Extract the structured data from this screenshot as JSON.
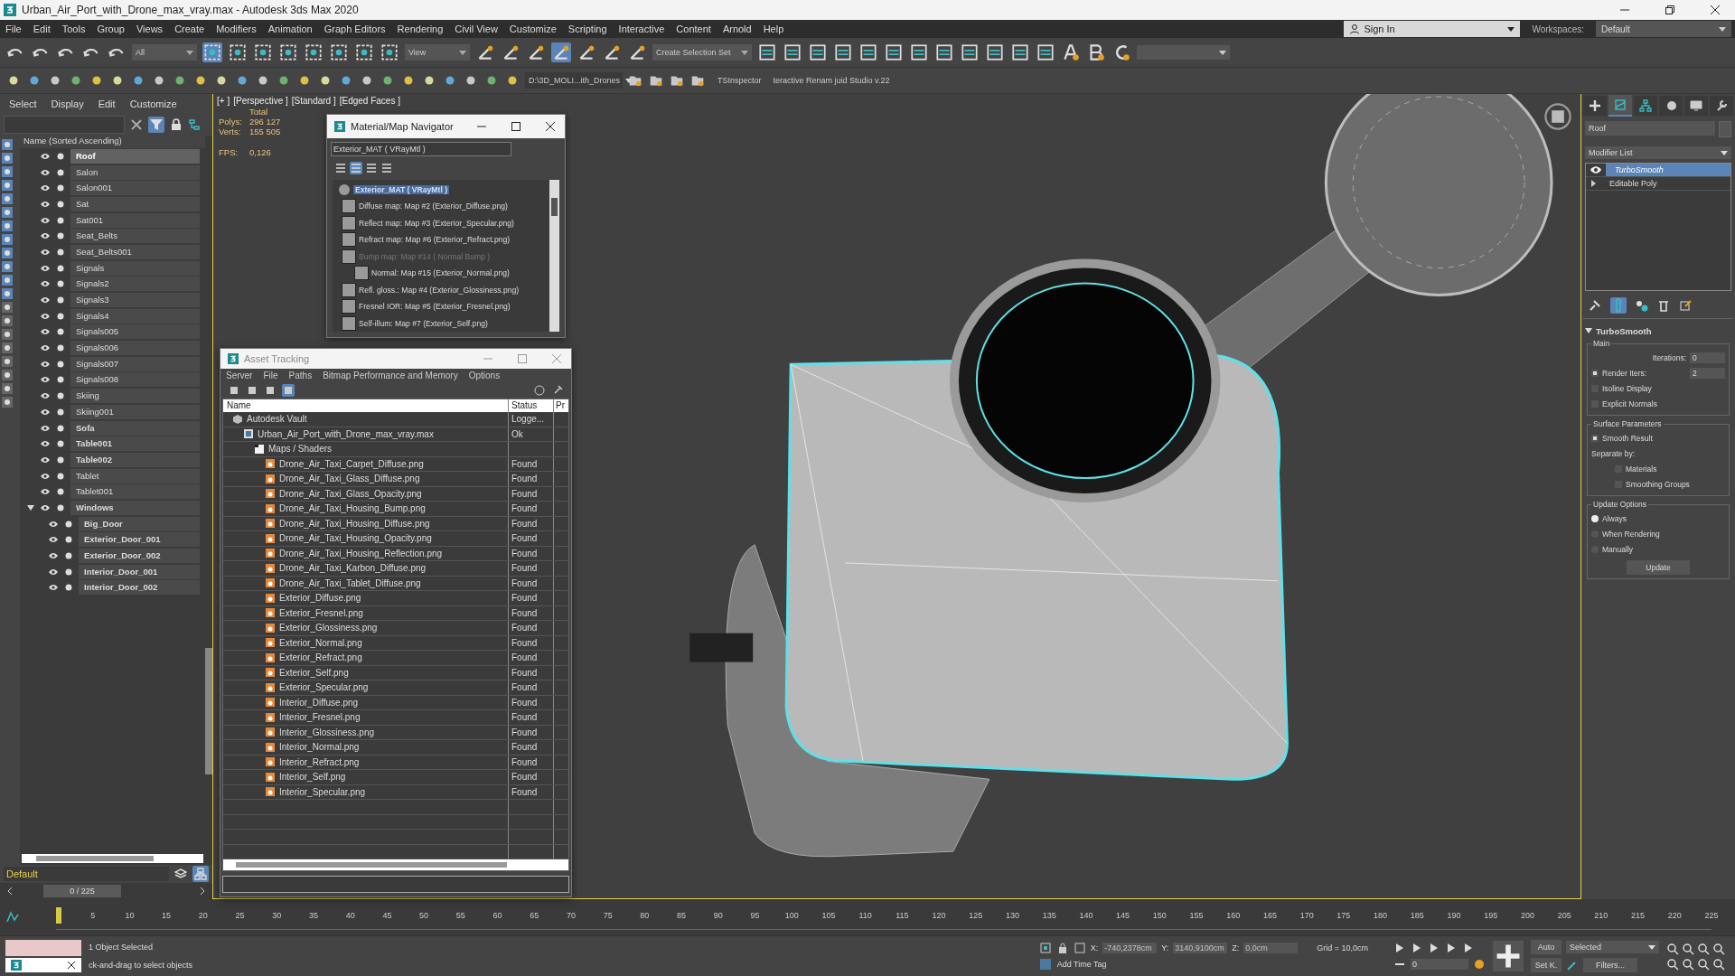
{
  "window": {
    "title": "Urban_Air_Port_with_Drone_max_vray.max - Autodesk 3ds Max 2020"
  },
  "menu_bar": [
    "File",
    "Edit",
    "Tools",
    "Group",
    "Views",
    "Create",
    "Modifiers",
    "Animation",
    "Graph Editors",
    "Rendering",
    "Civil View",
    "Customize",
    "Scripting",
    "Interactive",
    "Content",
    "Arnold",
    "Help"
  ],
  "toolbar": {
    "selection_filter": "All",
    "reference_coord": "View",
    "named_selection": "Create Selection Set"
  },
  "toolbar_2": {
    "project_path": "D:\\3D_MOLI...ith_Drones",
    "plugins": [
      "TSInspector",
      "teractive Renam juid Studio v.22"
    ]
  },
  "account": {
    "sign_in": "Sign In",
    "workspaces_label": "Workspaces:",
    "workspace": "Default"
  },
  "scene_explorer": {
    "menu": [
      "Select",
      "Display",
      "Edit",
      "Customize"
    ],
    "column": "Name (Sorted Ascending)",
    "items": [
      {
        "name": "Roof",
        "bold": true,
        "selected": true
      },
      {
        "name": "Salon",
        "bold": false,
        "selected": false
      },
      {
        "name": "Salon001",
        "bold": false,
        "selected": false
      },
      {
        "name": "Sat",
        "bold": false,
        "selected": false
      },
      {
        "name": "Sat001",
        "bold": false,
        "selected": false
      },
      {
        "name": "Seat_Belts",
        "bold": false,
        "selected": false
      },
      {
        "name": "Seat_Belts001",
        "bold": false,
        "selected": false
      },
      {
        "name": "Signals",
        "bold": false,
        "selected": false
      },
      {
        "name": "Signals2",
        "bold": false,
        "selected": false
      },
      {
        "name": "Signals3",
        "bold": false,
        "selected": false
      },
      {
        "name": "Signals4",
        "bold": false,
        "selected": false
      },
      {
        "name": "Signals005",
        "bold": false,
        "selected": false
      },
      {
        "name": "Signals006",
        "bold": false,
        "selected": false
      },
      {
        "name": "Signals007",
        "bold": false,
        "selected": false
      },
      {
        "name": "Signals008",
        "bold": false,
        "selected": false
      },
      {
        "name": "Skiing",
        "bold": false,
        "selected": false
      },
      {
        "name": "Skiing001",
        "bold": false,
        "selected": false
      },
      {
        "name": "Sofa",
        "bold": true,
        "selected": false
      },
      {
        "name": "Table001",
        "bold": true,
        "selected": false
      },
      {
        "name": "Table002",
        "bold": true,
        "selected": false
      },
      {
        "name": "Tablet",
        "bold": false,
        "selected": false
      },
      {
        "name": "Tablet001",
        "bold": false,
        "selected": false
      },
      {
        "name": "Windows",
        "bold": true,
        "selected": false,
        "expanded": true,
        "children": [
          {
            "name": "Big_Door",
            "bold": true,
            "selected": false
          },
          {
            "name": "Exterior_Door_001",
            "bold": true,
            "selected": false
          },
          {
            "name": "Exterior_Door_002",
            "bold": true,
            "selected": false
          },
          {
            "name": "Interior_Door_001",
            "bold": true,
            "selected": false
          },
          {
            "name": "Interior_Door_002",
            "bold": true,
            "selected": false
          }
        ]
      }
    ],
    "layer": "Default",
    "frame": "0 / 225"
  },
  "viewport": {
    "labels": [
      "[+ ]",
      "[Perspective ]",
      "[Standard ]",
      "[Edged Faces ]"
    ],
    "stats_header": "Total",
    "stats": [
      {
        "label": "Polys:",
        "value": "296 127"
      },
      {
        "label": "Verts:",
        "value": "155 505"
      }
    ],
    "fps_label": "FPS:",
    "fps": "0,126"
  },
  "material_navigator": {
    "title": "Material/Map Navigator",
    "field": "Exterior_MAT  ( VRayMtl )",
    "root": "Exterior_MAT  ( VRayMtl )",
    "maps": [
      {
        "label": "Diffuse map: Map #2 (Exterior_Diffuse.png)",
        "disabled": false
      },
      {
        "label": "Reflect map: Map #3 (Exterior_Specular.png)",
        "disabled": false
      },
      {
        "label": "Refract map: Map #6 (Exterior_Refract.png)",
        "disabled": false
      },
      {
        "label": "Bump map: Map #14  ( Normal Bump )",
        "disabled": true,
        "children": [
          {
            "label": "Normal: Map #15 (Exterior_Normal.png)",
            "disabled": false
          }
        ]
      },
      {
        "label": "Refl. gloss.: Map #4 (Exterior_Glossiness.png)",
        "disabled": false
      },
      {
        "label": "Fresnel IOR: Map #5 (Exterior_Fresnel.png)",
        "disabled": false
      },
      {
        "label": "Self-illum: Map #7 (Exterior_Self.png)",
        "disabled": false
      }
    ]
  },
  "asset_tracking": {
    "title": "Asset Tracking",
    "menu": [
      "Server",
      "File",
      "Paths",
      "Bitmap Performance and Memory",
      "Options"
    ],
    "columns": [
      "Name",
      "Status",
      "Pr"
    ],
    "rows": [
      {
        "kind": "vault",
        "name": "Autodesk Vault",
        "status": "Logge...",
        "children": [
          {
            "kind": "scene",
            "name": "Urban_Air_Port_with_Drone_max_vray.max",
            "status": "Ok",
            "children": [
              {
                "kind": "folder",
                "name": "Maps / Shaders",
                "children": [
                  {
                    "kind": "image",
                    "name": "Drone_Air_Taxi_Carpet_Diffuse.png",
                    "status": "Found"
                  },
                  {
                    "kind": "image",
                    "name": "Drone_Air_Taxi_Glass_Diffuse.png",
                    "status": "Found"
                  },
                  {
                    "kind": "image",
                    "name": "Drone_Air_Taxi_Glass_Opacity.png",
                    "status": "Found"
                  },
                  {
                    "kind": "image",
                    "name": "Drone_Air_Taxi_Housing_Bump.png",
                    "status": "Found"
                  },
                  {
                    "kind": "image",
                    "name": "Drone_Air_Taxi_Housing_Diffuse.png",
                    "status": "Found"
                  },
                  {
                    "kind": "image",
                    "name": "Drone_Air_Taxi_Housing_Opacity.png",
                    "status": "Found"
                  },
                  {
                    "kind": "image",
                    "name": "Drone_Air_Taxi_Housing_Reflection.png",
                    "status": "Found"
                  },
                  {
                    "kind": "image",
                    "name": "Drone_Air_Taxi_Karbon_Diffuse.png",
                    "status": "Found"
                  },
                  {
                    "kind": "image",
                    "name": "Drone_Air_Taxi_Tablet_Diffuse.png",
                    "status": "Found"
                  },
                  {
                    "kind": "image",
                    "name": "Exterior_Diffuse.png",
                    "status": "Found"
                  },
                  {
                    "kind": "image",
                    "name": "Exterior_Fresnel.png",
                    "status": "Found"
                  },
                  {
                    "kind": "image",
                    "name": "Exterior_Glossiness.png",
                    "status": "Found"
                  },
                  {
                    "kind": "image",
                    "name": "Exterior_Normal.png",
                    "status": "Found"
                  },
                  {
                    "kind": "image",
                    "name": "Exterior_Refract.png",
                    "status": "Found"
                  },
                  {
                    "kind": "image",
                    "name": "Exterior_Self.png",
                    "status": "Found"
                  },
                  {
                    "kind": "image",
                    "name": "Exterior_Specular.png",
                    "status": "Found"
                  },
                  {
                    "kind": "image",
                    "name": "Interior_Diffuse.png",
                    "status": "Found"
                  },
                  {
                    "kind": "image",
                    "name": "Interior_Fresnel.png",
                    "status": "Found"
                  },
                  {
                    "kind": "image",
                    "name": "Interior_Glossiness.png",
                    "status": "Found"
                  },
                  {
                    "kind": "image",
                    "name": "Interior_Normal.png",
                    "status": "Found"
                  },
                  {
                    "kind": "image",
                    "name": "Interior_Refract.png",
                    "status": "Found"
                  },
                  {
                    "kind": "image",
                    "name": "Interior_Self.png",
                    "status": "Found"
                  },
                  {
                    "kind": "image",
                    "name": "Interior_Specular.png",
                    "status": "Found"
                  }
                ]
              }
            ]
          }
        ]
      }
    ]
  },
  "command_panel": {
    "tabs": [
      {
        "kind": "create",
        "selected": false
      },
      {
        "kind": "modify",
        "selected": true
      },
      {
        "kind": "hierarchy",
        "selected": false
      },
      {
        "kind": "motion",
        "selected": false
      },
      {
        "kind": "display",
        "selected": false
      },
      {
        "kind": "utilities",
        "selected": false
      }
    ],
    "object_name": "Roof",
    "modifier_list": "Modifier List",
    "stack": [
      {
        "label": "TurboSmooth",
        "selected": true
      },
      {
        "label": "Editable Poly",
        "selected": false
      }
    ],
    "rollout": {
      "title": "TurboSmooth",
      "main": "Main",
      "iterations_label": "Iterations:",
      "iterations": "0",
      "render_iters": {
        "label": "Render Iters:",
        "checked": true,
        "value": "2"
      },
      "options": [
        {
          "label": "Isoline Display",
          "checked": false
        },
        {
          "label": "Explicit Normals",
          "checked": false
        }
      ],
      "surface_title": "Surface Parameters",
      "smooth_result": {
        "label": "Smooth Result",
        "checked": true
      },
      "separate_by": "Separate by:",
      "separate_options": [
        {
          "label": "Materials",
          "checked": false
        },
        {
          "label": "Smoothing Groups",
          "checked": false
        }
      ],
      "update_title": "Update Options",
      "update_modes": [
        {
          "label": "Always",
          "selected": true
        },
        {
          "label": "When Rendering",
          "selected": false
        },
        {
          "label": "Manually",
          "selected": false
        }
      ],
      "update_button": "Update"
    }
  },
  "timeline": {
    "level": 0,
    "ticks": [
      "5",
      "10",
      "15",
      "20",
      "25",
      "30",
      "35",
      "40",
      "45",
      "50",
      "55",
      "60",
      "65",
      "70",
      "75",
      "80",
      "85",
      "90",
      "95",
      "100",
      "105",
      "110",
      "115",
      "120",
      "125",
      "130",
      "135",
      "140",
      "145",
      "150",
      "155",
      "160",
      "165",
      "170",
      "175",
      "180",
      "185",
      "190",
      "195",
      "200",
      "205",
      "210",
      "215",
      "220",
      "225"
    ]
  },
  "status_bar": {
    "selection": "1 Object Selected",
    "prompt": "ck-and-drag to select objects",
    "coords": [
      {
        "label": "X:",
        "value": "-740,2378cm"
      },
      {
        "label": "Y:",
        "value": "3140,9100cm"
      },
      {
        "label": "Z:",
        "value": "0,0cm"
      }
    ],
    "grid": "Grid = 10,0cm",
    "add_time_tag": "Add Time Tag",
    "auto": "Auto",
    "key_filter": "Selected",
    "set_key": "Set K.",
    "filters": "Filters...",
    "frame": "0"
  }
}
